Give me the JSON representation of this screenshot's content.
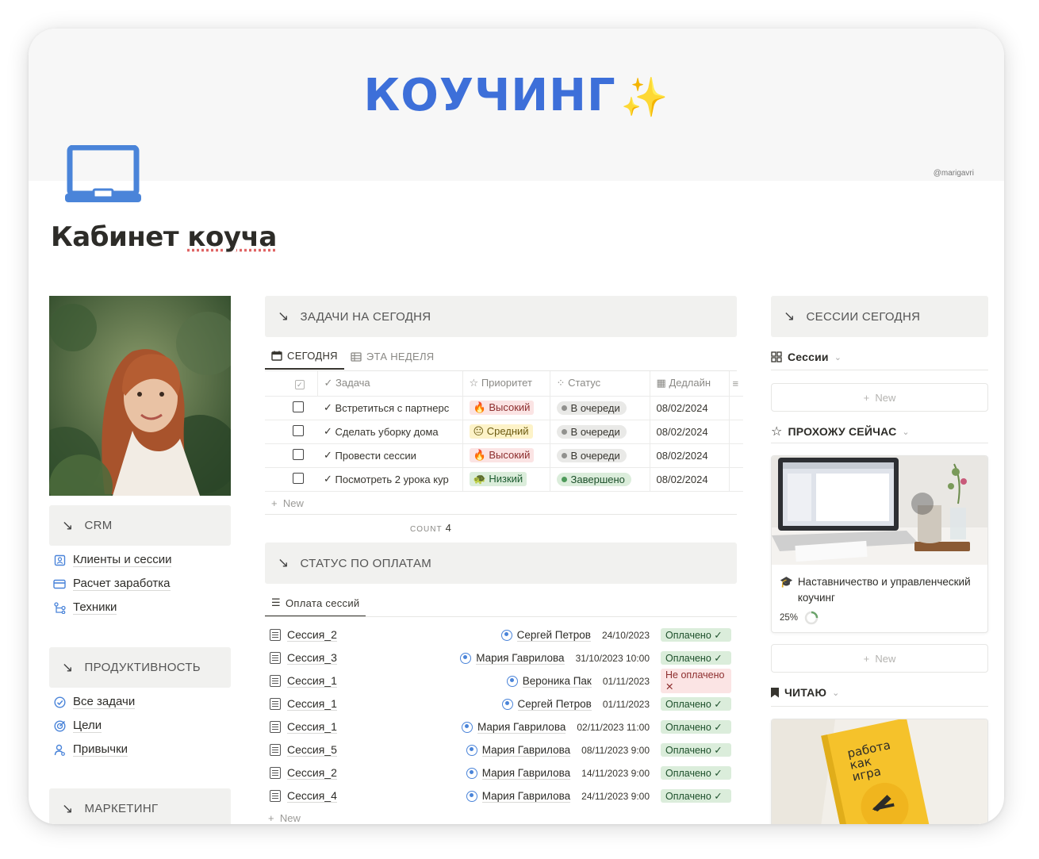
{
  "cover": {
    "title": "КОУЧИНГ",
    "sparkle": "✨",
    "credit": "@marigavri"
  },
  "page": {
    "title_part1": "Кабинет",
    "title_part2": "коуча",
    "icon": "laptop-icon"
  },
  "left": {
    "crm": {
      "header": "CRM",
      "links": [
        {
          "icon": "contact-card-icon",
          "label": "Клиенты и сессии"
        },
        {
          "icon": "credit-card-icon",
          "label": "Расчет заработка"
        },
        {
          "icon": "hierarchy-icon",
          "label": "Техники"
        }
      ]
    },
    "productivity": {
      "header": "ПРОДУКТИВНОСТЬ",
      "links": [
        {
          "icon": "check-circle-icon",
          "label": "Все задачи"
        },
        {
          "icon": "target-icon",
          "label": "Цели"
        },
        {
          "icon": "person-icon",
          "label": "Привычки"
        }
      ]
    },
    "marketing": {
      "header": "МАРКЕТИНГ"
    }
  },
  "tasks": {
    "header": "ЗАДАЧИ НА СЕГОДНЯ",
    "tabs": [
      {
        "label": "СЕГОДНЯ",
        "icon": "calendar-icon"
      },
      {
        "label": "ЭТА НЕДЕЛЯ",
        "icon": "table-icon"
      }
    ],
    "columns": {
      "task": "Задача",
      "priority": "Приоритет",
      "status": "Статус",
      "deadline": "Дедлайн"
    },
    "rows": [
      {
        "name": "Встретиться с партнерс",
        "priority": "Высокий",
        "priority_emoji": "🔥",
        "status": "В очереди",
        "deadline": "08/02/2024"
      },
      {
        "name": "Сделать уборку дома",
        "priority": "Средний",
        "priority_emoji": "😐",
        "status": "В очереди",
        "deadline": "08/02/2024"
      },
      {
        "name": "Провести сессии",
        "priority": "Высокий",
        "priority_emoji": "🔥",
        "status": "В очереди",
        "deadline": "08/02/2024"
      },
      {
        "name": "Посмотреть 2 урока кур",
        "priority": "Низкий",
        "priority_emoji": "🐢",
        "status": "Завершено",
        "deadline": "08/02/2024"
      }
    ],
    "new_label": "New",
    "count_label": "COUNT",
    "count_value": "4"
  },
  "payments": {
    "header": "СТАТУС ПО ОПЛАТАМ",
    "tab": {
      "label": "Оплата сессий",
      "icon": "list-icon"
    },
    "rows": [
      {
        "session": "Сессия_2",
        "person": "Сергей Петров",
        "date": "24/10/2023",
        "status": "Оплачено",
        "paid": true
      },
      {
        "session": "Сессия_3",
        "person": "Мария Гаврилова",
        "date": "31/10/2023 10:00",
        "status": "Оплачено",
        "paid": true
      },
      {
        "session": "Сессия_1",
        "person": "Вероника Пак",
        "date": "01/11/2023",
        "status": "Не оплачено",
        "paid": false
      },
      {
        "session": "Сессия_1",
        "person": "Сергей Петров",
        "date": "01/11/2023",
        "status": "Оплачено",
        "paid": true
      },
      {
        "session": "Сессия_1",
        "person": "Мария Гаврилова",
        "date": "02/11/2023 11:00",
        "status": "Оплачено",
        "paid": true
      },
      {
        "session": "Сессия_5",
        "person": "Мария Гаврилова",
        "date": "08/11/2023 9:00",
        "status": "Оплачено",
        "paid": true
      },
      {
        "session": "Сессия_2",
        "person": "Мария Гаврилова",
        "date": "14/11/2023 9:00",
        "status": "Оплачено",
        "paid": true
      },
      {
        "session": "Сессия_4",
        "person": "Мария Гаврилова",
        "date": "24/11/2023 9:00",
        "status": "Оплачено",
        "paid": true
      }
    ],
    "new_label": "New"
  },
  "right": {
    "sessions_header": "СЕССИИ СЕГОДНЯ",
    "sessions_view": "Сессии",
    "new_label": "New",
    "course_view": "ПРОХОЖУ СЕЙЧАС",
    "course": {
      "title": "Наставничество и управленческий коучинг",
      "progress": "25%",
      "progress_value": 0.25
    },
    "reading_view": "ЧИТАЮ",
    "book": {
      "title_lines": [
        "работа",
        "как",
        "игра"
      ]
    }
  },
  "colors": {
    "accent": "#3d6fd9",
    "sparkle": "#f0c64a",
    "callout_bg": "#f1f1ef"
  }
}
